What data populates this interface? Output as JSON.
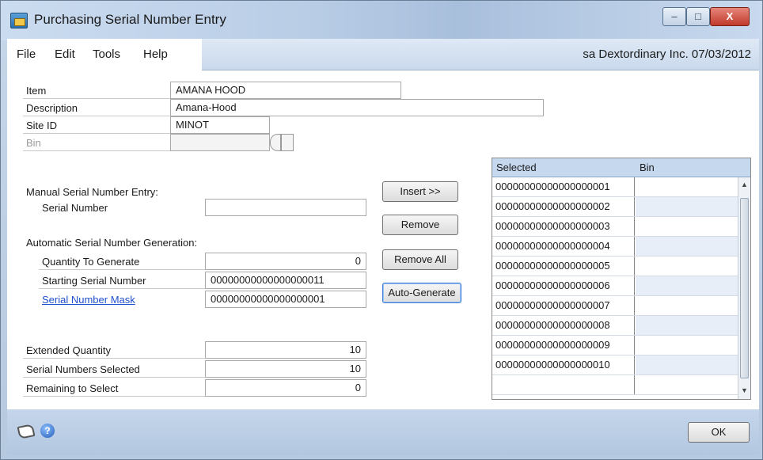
{
  "window": {
    "title": "Purchasing Serial Number Entry",
    "controls": {
      "minimize": "–",
      "maximize": "□",
      "close": "X"
    }
  },
  "menu": {
    "items": [
      "File",
      "Edit",
      "Tools",
      "Help"
    ],
    "status": "sa  Dextordinary Inc.  07/03/2012"
  },
  "form": {
    "item_label": "Item",
    "item_value": "AMANA HOOD",
    "description_label": "Description",
    "description_value": "Amana-Hood",
    "site_label": "Site ID",
    "site_value": "MINOT",
    "bin_label": "Bin",
    "bin_value": "",
    "manual_section": "Manual Serial Number Entry:",
    "serial_number_label": "Serial Number",
    "serial_number_value": "",
    "auto_section": "Automatic Serial Number Generation:",
    "qty_generate_label": "Quantity To Generate",
    "qty_generate_value": "0",
    "starting_serial_label": "Starting Serial Number",
    "starting_serial_value": "00000000000000000011",
    "mask_label": "Serial Number Mask",
    "mask_value": "00000000000000000001",
    "extended_qty_label": "Extended Quantity",
    "extended_qty_value": "10",
    "selected_label": "Serial Numbers Selected",
    "selected_value": "10",
    "remaining_label": "Remaining to Select",
    "remaining_value": "0"
  },
  "buttons": {
    "insert": "Insert >>",
    "remove": "Remove",
    "remove_all": "Remove All",
    "auto_generate": "Auto-Generate",
    "ok": "OK"
  },
  "grid": {
    "columns": [
      "Selected",
      "Bin"
    ],
    "rows": [
      {
        "selected": "00000000000000000001",
        "bin": ""
      },
      {
        "selected": "00000000000000000002",
        "bin": ""
      },
      {
        "selected": "00000000000000000003",
        "bin": ""
      },
      {
        "selected": "00000000000000000004",
        "bin": ""
      },
      {
        "selected": "00000000000000000005",
        "bin": ""
      },
      {
        "selected": "00000000000000000006",
        "bin": ""
      },
      {
        "selected": "00000000000000000007",
        "bin": ""
      },
      {
        "selected": "00000000000000000008",
        "bin": ""
      },
      {
        "selected": "00000000000000000009",
        "bin": ""
      },
      {
        "selected": "00000000000000000010",
        "bin": ""
      },
      {
        "selected": "",
        "bin": ""
      }
    ]
  },
  "icons": [
    "app-icon",
    "note-icon",
    "help-icon",
    "scroll-up-icon",
    "scroll-down-icon"
  ]
}
